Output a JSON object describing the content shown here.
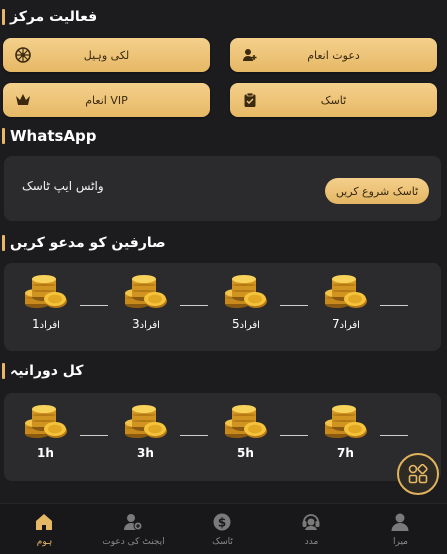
{
  "activity": {
    "title": "فعالیت مرکز",
    "buttons": [
      {
        "label": "لکی وہیل",
        "icon": "wheel-icon"
      },
      {
        "label": "دعوت انعام",
        "icon": "invite-user-icon"
      },
      {
        "label": "انعام VIP",
        "icon": "crown-icon"
      },
      {
        "label": "ٹاسک",
        "icon": "clipboard-icon"
      }
    ]
  },
  "whatsapp": {
    "title": "WhatsApp",
    "task_text": "واٹس ایپ ٹاسک",
    "start_label": "ٹاسک شروع کریں"
  },
  "invite": {
    "title": "صارفین کو مدعو کریں",
    "steps": [
      {
        "unit": "افراد",
        "count": "1"
      },
      {
        "unit": "افراد",
        "count": "3"
      },
      {
        "unit": "افراد",
        "count": "5"
      },
      {
        "unit": "افراد",
        "count": "7"
      }
    ]
  },
  "duration": {
    "title": "کل دورانیہ",
    "steps": [
      "1h",
      "3h",
      "5h",
      "7h"
    ]
  },
  "nav": {
    "items": [
      {
        "label": "ہوم",
        "icon": "home-icon",
        "active": true
      },
      {
        "label": "ایجنٹ کی دعوت",
        "icon": "agent-invite-icon",
        "active": false
      },
      {
        "label": "ٹاسک",
        "icon": "dollar-coin-icon",
        "active": false
      },
      {
        "label": "مدد",
        "icon": "support-icon",
        "active": false
      },
      {
        "label": "میرا",
        "icon": "profile-icon",
        "active": false
      }
    ]
  },
  "colors": {
    "accent": "#e6b865",
    "background": "#1c1c1e",
    "card": "#2b2b2d"
  }
}
